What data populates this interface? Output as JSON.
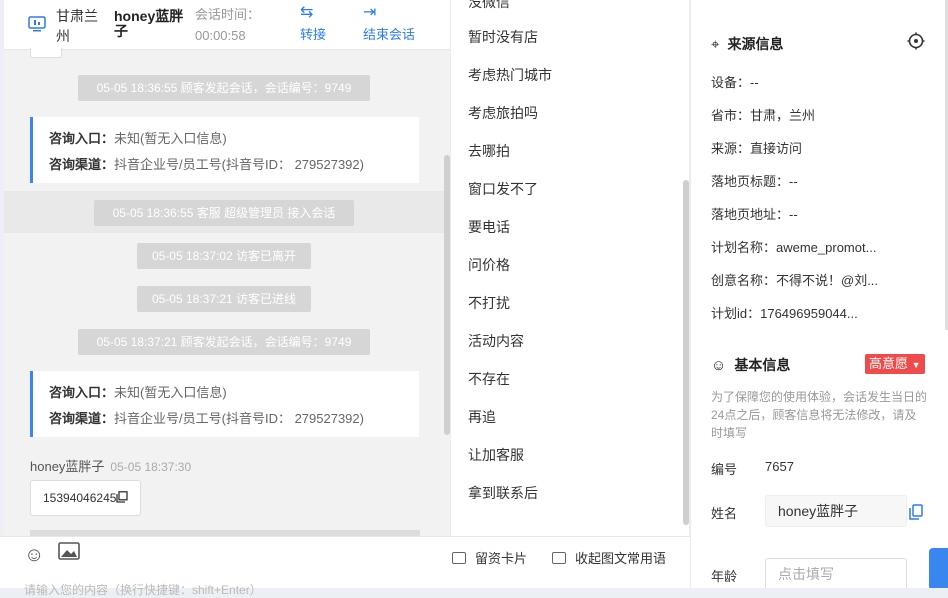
{
  "header": {
    "visitor_location": "甘肃兰州",
    "visitor_name": "honey蓝胖子",
    "session_label": "会话时间：",
    "session_time": "00:00:58",
    "transfer_label": "转接",
    "end_label": "结束会话"
  },
  "chat": {
    "sys_messages": [
      "05-05 18:36:55 顾客发起会话，会话编号：9749",
      "05-05 18:36:55 客服 超级管理员 接入会话",
      "05-05 18:37:02 访客已离开",
      "05-05 18:37:21 访客已进线",
      "05-05 18:37:21 顾客发起会话，会话编号：9749"
    ],
    "cards": [
      {
        "entry_label": "咨询入口：",
        "entry_value": "未知(暂无入口信息)",
        "channel_label": "咨询渠道：",
        "channel_value": "抖音企业号/员工号(抖音号ID： 279527392)"
      },
      {
        "entry_label": "咨询入口：",
        "entry_value": "未知(暂无入口信息)",
        "channel_label": "咨询渠道：",
        "channel_value": "抖音企业号/员工号(抖音号ID： 279527392)"
      }
    ],
    "last_sender": "honey蓝胖子",
    "last_time": "05-05 18:37:30",
    "last_message": "15394046245"
  },
  "composer": {
    "placeholder": "请输入您的内容（换行快捷键：shift+Enter）"
  },
  "quick_replies": {
    "items": [
      "没微信",
      "暂时没有店",
      "考虑热门城市",
      "考虑旅拍吗",
      "去哪拍",
      "窗口发不了",
      "要电话",
      "问价格",
      "不打扰",
      "活动内容",
      "不存在",
      "再追",
      "让加客服",
      "拿到联系后"
    ],
    "tool_card": "留资卡片",
    "tool_collapse": "收起图文常用语"
  },
  "source_info": {
    "title": "来源信息",
    "device": "设备：--",
    "province": "省市：甘肃，兰州",
    "source": "来源：直接访问",
    "landing_title": "落地页标题：--",
    "landing_url": "落地页地址：--",
    "plan_name": "计划名称：aweme_promot...",
    "creative_name": "创意名称：不得不说！@刘...",
    "plan_id": "计划id：176496959044..."
  },
  "basic_info": {
    "title": "基本信息",
    "intent_tag": "高意愿",
    "notice": "为了保障您的使用体验，会话发生当日的24点之后，顾客信息将无法修改，请及时填写",
    "id_label": "编号",
    "id_value": "7657",
    "name_label": "姓名",
    "name_value": "honey蓝胖子",
    "age_label": "年龄",
    "age_placeholder": "点击填写"
  },
  "colors": {
    "accent": "#2b7de9",
    "card_border": "#3a86f0",
    "tag_red": "#ef4b4b"
  }
}
